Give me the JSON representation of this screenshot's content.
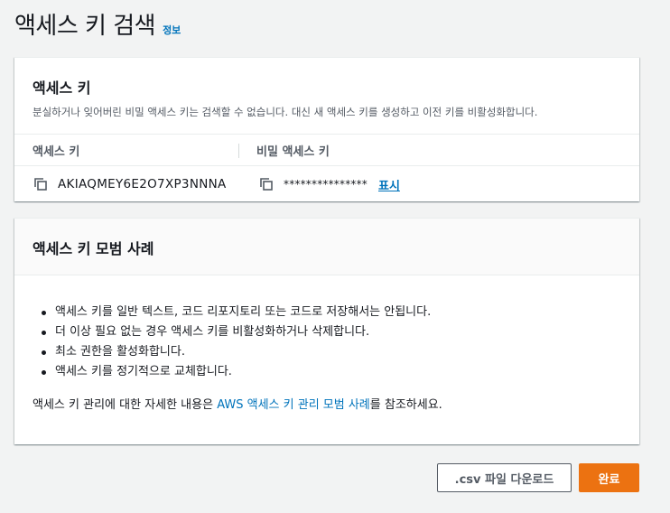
{
  "header": {
    "title": "액세스 키 검색",
    "info_link": "정보"
  },
  "retrieve_card": {
    "title": "액세스 키",
    "description": "분실하거나 잊어버린 비밀 액세스 키는 검색할 수 없습니다. 대신 새 액세스 키를 생성하고 이전 키를 비활성화합니다.",
    "columns": [
      "액세스 키",
      "비밀 액세스 키"
    ],
    "access_key_id": "AKIAQMEY6E2O7XP3NNNA",
    "secret_key_masked": "***************",
    "show_label": "표시"
  },
  "best_practices": {
    "title": "액세스 키 모범 사례",
    "items": [
      "액세스 키를 일반 텍스트, 코드 리포지토리 또는 코드로 저장해서는 안됩니다.",
      "더 이상 필요 없는 경우 액세스 키를 비활성화하거나 삭제합니다.",
      "최소 권한을 활성화합니다.",
      "액세스 키를 정기적으로 교체합니다."
    ],
    "footer_prefix": "액세스 키 관리에 대한 자세한 내용은 ",
    "footer_link": "AWS 액세스 키 관리 모범 사례",
    "footer_suffix": "를 참조하세요."
  },
  "actions": {
    "download_label": ".csv 파일 다운로드",
    "done_label": "완료"
  },
  "colors": {
    "link": "#0073bb",
    "primary": "#ec7211",
    "background": "#f2f3f3"
  },
  "icons": {
    "copy": "copy-icon"
  }
}
